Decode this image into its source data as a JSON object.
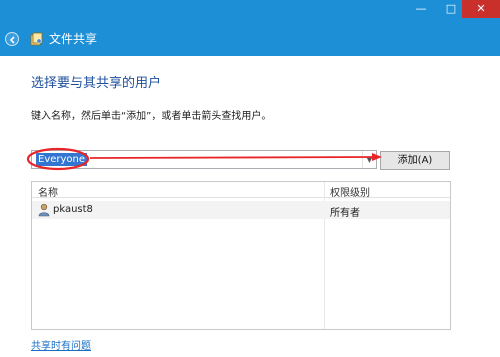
{
  "window": {
    "minimize_glyph": "—",
    "maximize_glyph": "□",
    "close_glyph": "✕"
  },
  "nav": {
    "title": "文件共享",
    "back_icon": "back-arrow-icon",
    "app_icon": "file-sharing-icon"
  },
  "content": {
    "heading": "选择要与其共享的用户",
    "instruction": "键入名称，然后单击“添加”，或者单击箭头查找用户。"
  },
  "combo": {
    "value": "Everyone"
  },
  "add_button": {
    "label": "添加(A)"
  },
  "table": {
    "columns": [
      "名称",
      "权限级别"
    ],
    "rows": [
      {
        "name": "pkaust8",
        "permission": "所有者",
        "icon": "user-icon"
      }
    ]
  },
  "help_link": "共享时有问题",
  "colors": {
    "titlebar": "#1d8fd6",
    "heading": "#1e4f9c",
    "annotation": "#e8262a",
    "selection": "#3376d1"
  }
}
